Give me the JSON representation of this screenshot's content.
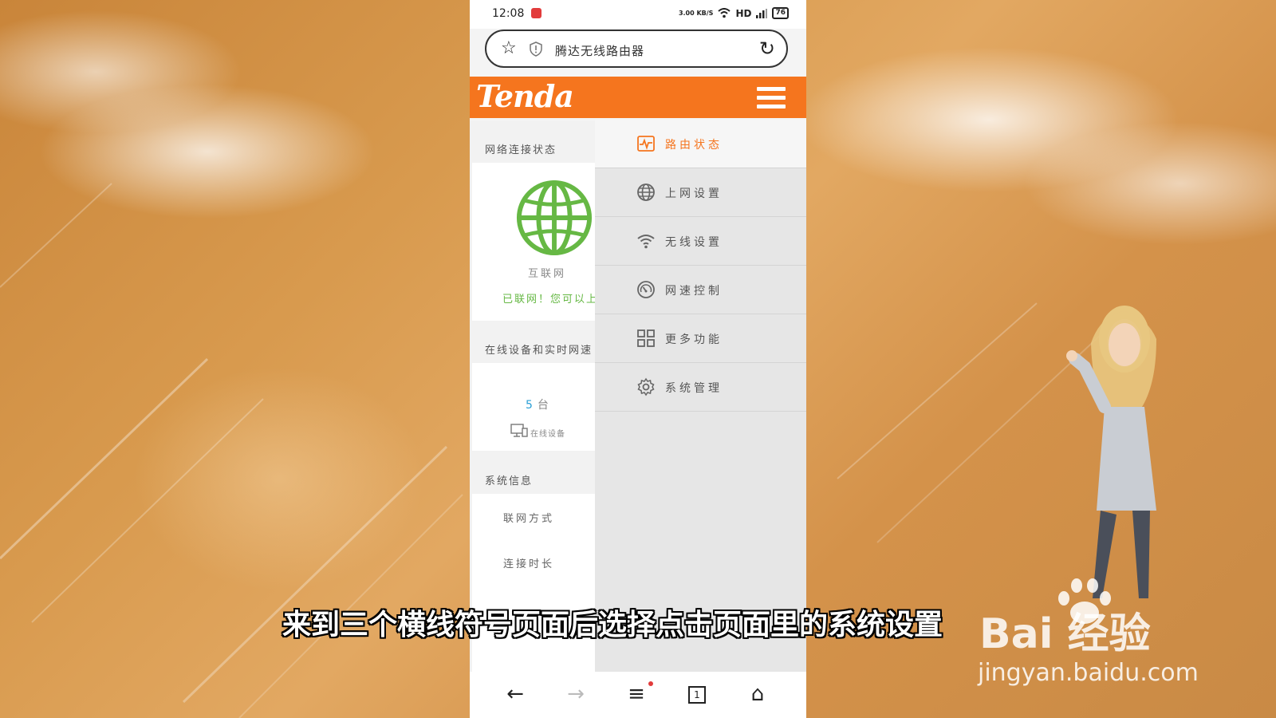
{
  "status_bar": {
    "time": "12:08",
    "speed": "3.00 KB/S",
    "network": "HD",
    "battery": "76"
  },
  "browser": {
    "url_title": "腾达无线路由器"
  },
  "header": {
    "logo": "Tenda"
  },
  "left_panel": {
    "network_status_title": "网络连接状态",
    "internet_label": "互联网",
    "connected_text": "已联网！您可以上",
    "devices_title": "在线设备和实时网速",
    "device_count": "5",
    "device_unit": "台",
    "online_devices_label": "在线设备",
    "system_info_title": "系统信息",
    "info_rows": [
      "联网方式",
      "连接时长"
    ]
  },
  "menu": {
    "items": [
      {
        "label": "路由状态",
        "icon": "pulse-icon",
        "active": true
      },
      {
        "label": "上网设置",
        "icon": "globe-icon",
        "active": false
      },
      {
        "label": "无线设置",
        "icon": "wifi-icon",
        "active": false
      },
      {
        "label": "网速控制",
        "icon": "speedometer-icon",
        "active": false
      },
      {
        "label": "更多功能",
        "icon": "grid-icon",
        "active": false
      },
      {
        "label": "系统管理",
        "icon": "gear-icon",
        "active": false
      }
    ]
  },
  "nav_bar": {
    "back": "←",
    "forward": "→",
    "menu": "≡",
    "tabs": "1",
    "home": "⌂"
  },
  "subtitle": "来到三个横线符号页面后选择点击页面里的系统设置",
  "watermark": {
    "logo": "Bai  经验",
    "url": "jingyan.baidu.com"
  },
  "colors": {
    "brand_orange": "#f5751e",
    "connected_green": "#66b844",
    "count_blue": "#2a9fd6"
  }
}
